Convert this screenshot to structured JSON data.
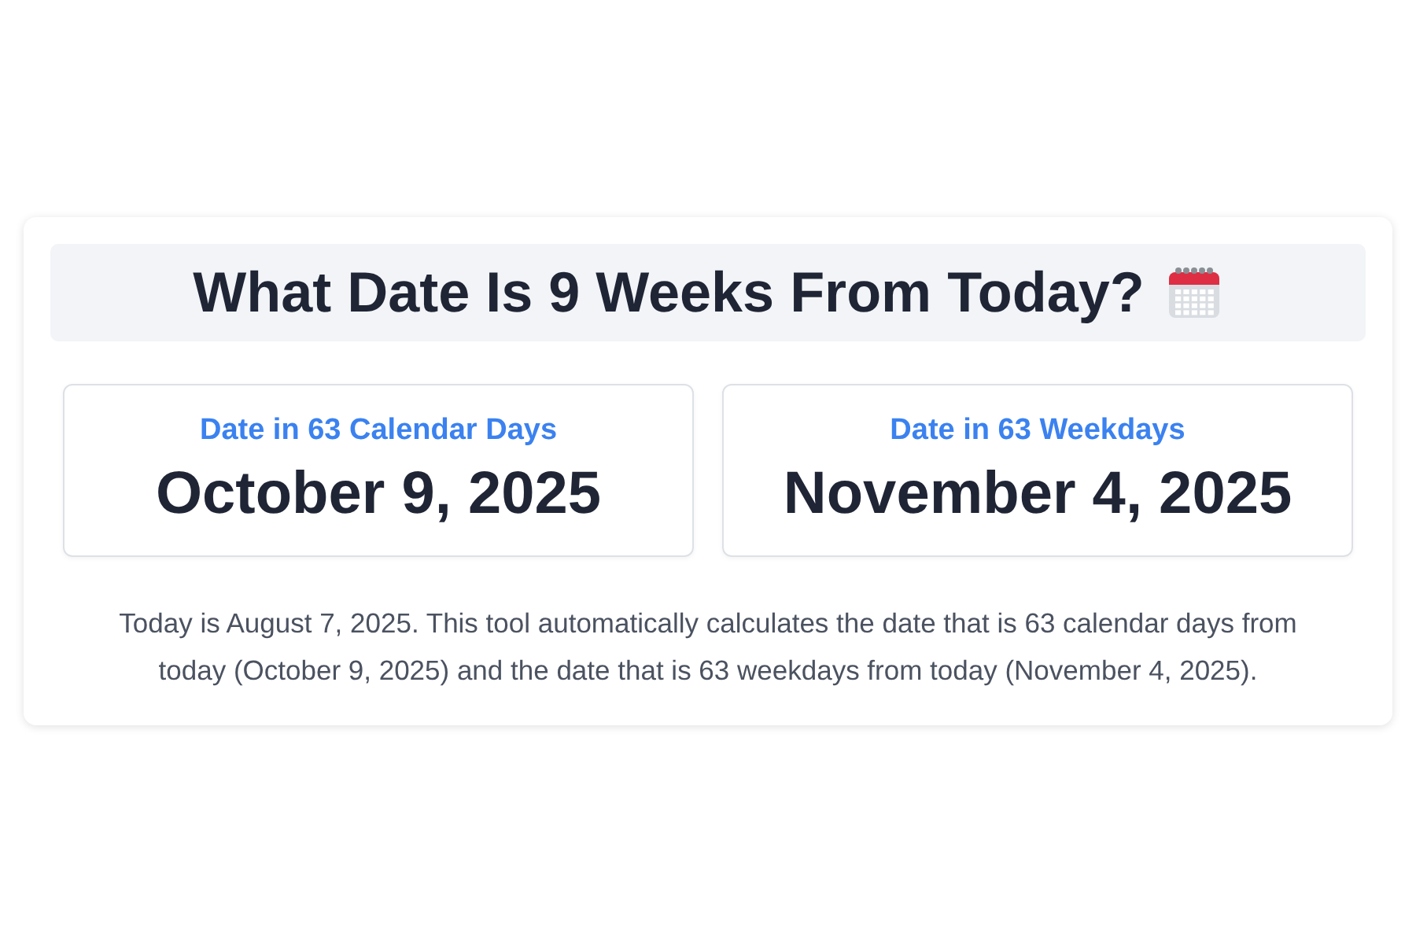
{
  "title": "What Date Is 9 Weeks From Today?",
  "results": [
    {
      "label": "Date in 63 Calendar Days",
      "date": "October 9, 2025"
    },
    {
      "label": "Date in 63 Weekdays",
      "date": "November 4, 2025"
    }
  ],
  "description": "Today is August 7, 2025. This tool automatically calculates the date that is 63 calendar days from today (October 9, 2025) and the date that is 63 weekdays from today (November 4, 2025)."
}
